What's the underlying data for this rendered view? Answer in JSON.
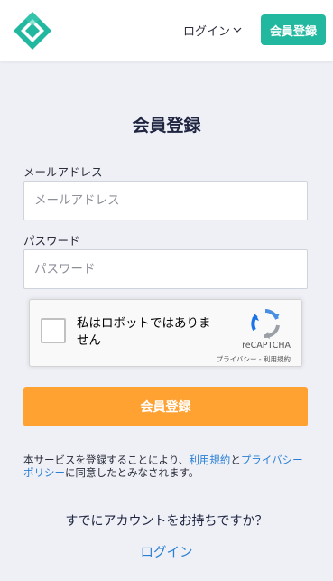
{
  "header": {
    "login_label": "ログイン",
    "signup_label": "会員登録",
    "accent_color": "#22b8a0"
  },
  "form": {
    "title": "会員登録",
    "email_label": "メールアドレス",
    "email_placeholder": "メールアドレス",
    "password_label": "パスワード",
    "password_placeholder": "パスワード",
    "submit_label": "会員登録",
    "submit_color": "#ffa232"
  },
  "captcha": {
    "text": "私はロボットではありません",
    "brand": "reCAPTCHA",
    "privacy": "プライバシー",
    "separator": " - ",
    "terms": "利用規約"
  },
  "terms": {
    "prefix": "本サービスを登録することにより、",
    "terms_link": "利用規約",
    "and": "と",
    "privacy_link": "プライバシーポリシー",
    "suffix": "に同意したとみなされます。"
  },
  "footer": {
    "have_account": "すでにアカウントをお持ちですか？",
    "login_link": "ログイン"
  }
}
